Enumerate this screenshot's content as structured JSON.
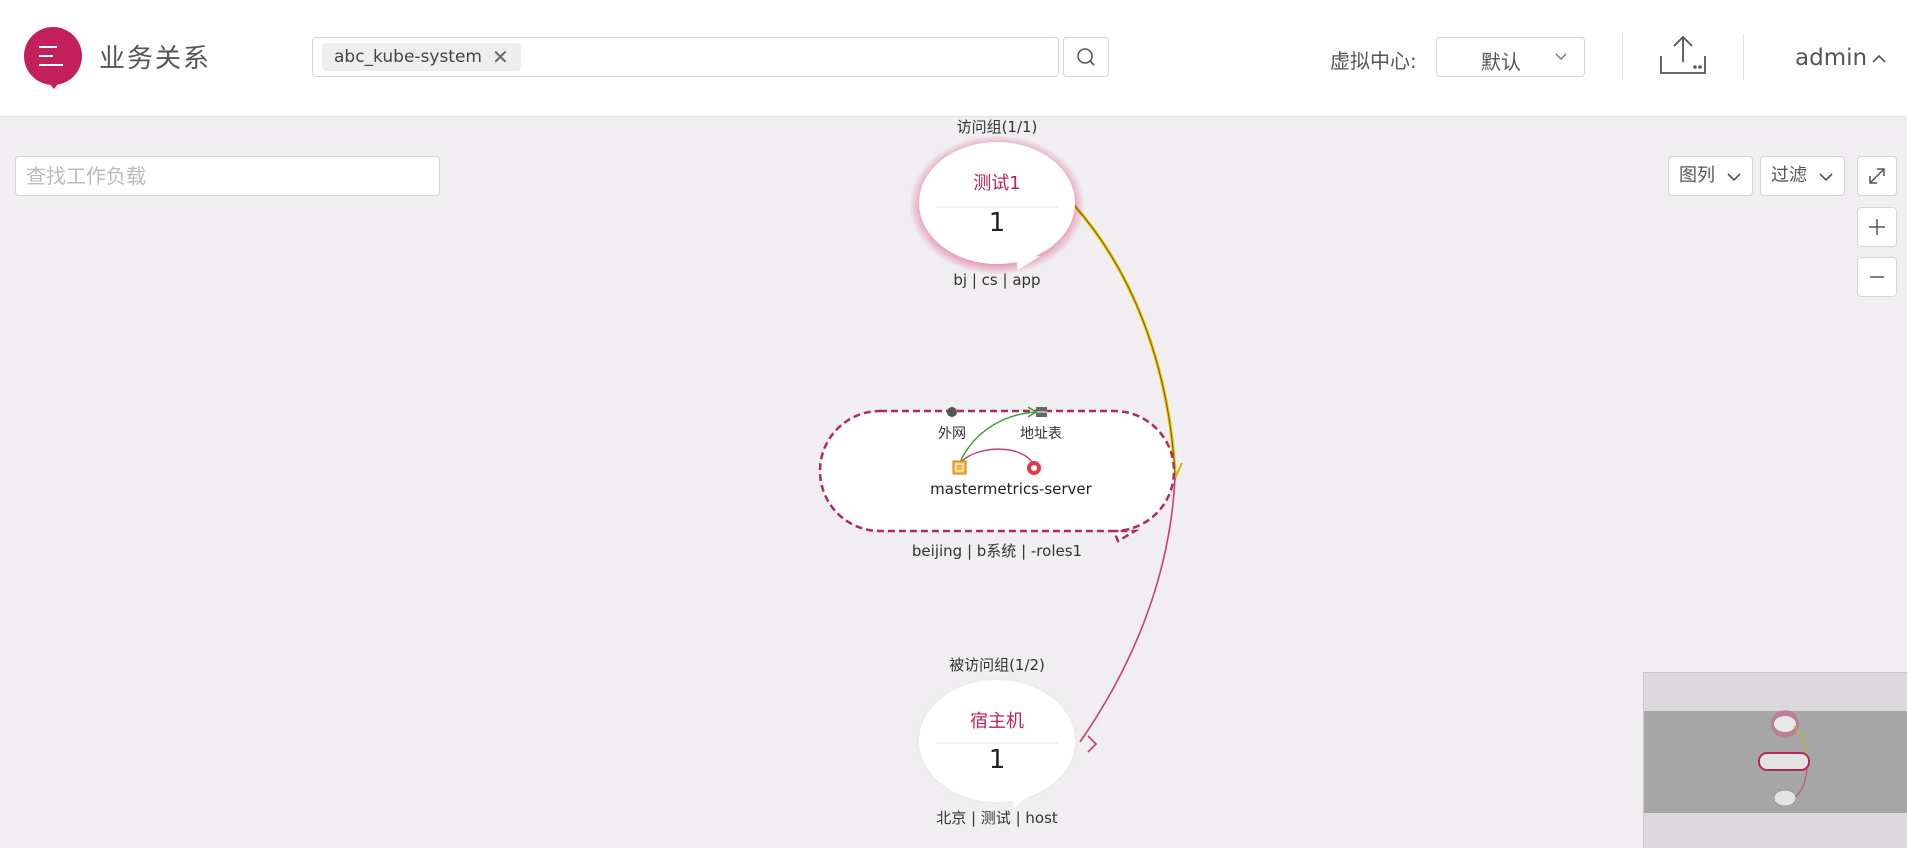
{
  "header": {
    "app_title": "业务关系",
    "search_tag": "abc_kube-system",
    "search_tag_remove": "✕",
    "virtual_center_label": "虚拟中心:",
    "virtual_center_value": "默认",
    "user": "admin"
  },
  "toolbar": {
    "workload_search_placeholder": "查找工作负载",
    "legend_label": "图列",
    "filter_label": "过滤",
    "zoom_in": "+",
    "zoom_out": "−"
  },
  "graph": {
    "top_group": {
      "title": "访问组(1/1)",
      "name": "测试1",
      "count": "1",
      "tags": "bj | cs | app"
    },
    "middle_group": {
      "external_label": "外网",
      "address_label": "地址表",
      "workload_name": "mastermetrics-server",
      "tags": "beijing | b系统 | -roles1"
    },
    "bottom_group": {
      "title": "被访问组(1/2)",
      "name": "宿主机",
      "count": "1",
      "tags": "北京 | 测试 | host"
    }
  },
  "colors": {
    "brand": "#c21f5b",
    "edge_yellow": "#e6c300",
    "edge_pink": "#c5416f",
    "edge_green": "#3f9a3f"
  },
  "icons": [
    "menu-icon",
    "close-icon",
    "search-icon",
    "chevron-down-icon",
    "upload-icon",
    "chevron-up-icon",
    "fullscreen-icon",
    "plus-icon",
    "minus-icon",
    "cloud-icon",
    "table-icon",
    "workload-icon",
    "target-icon"
  ]
}
